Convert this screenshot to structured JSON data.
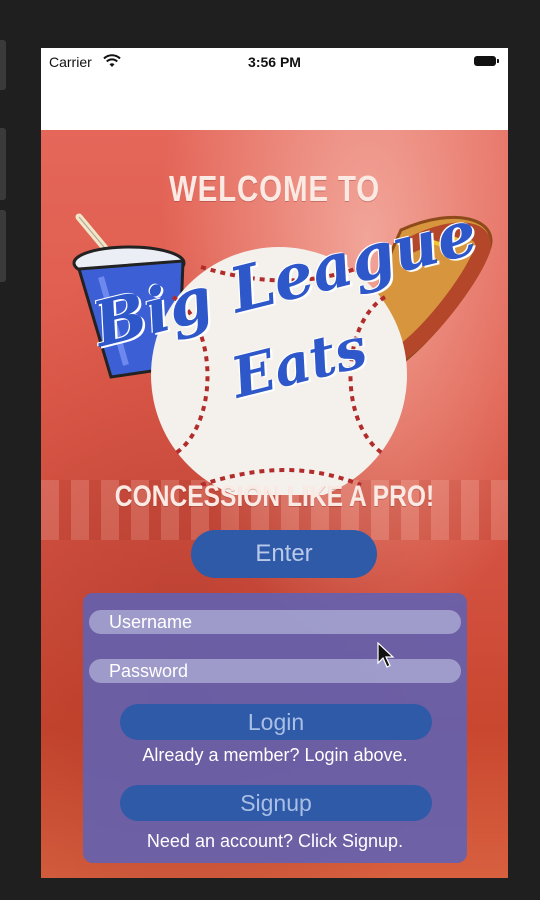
{
  "status_bar": {
    "carrier": "Carrier",
    "time": "3:56 PM"
  },
  "hero": {
    "welcome": "WELCOME TO",
    "logo_line1": "Big League",
    "logo_line2": "Eats",
    "tagline": "CONCESSION LIKE A PRO!",
    "enter_label": "Enter"
  },
  "auth": {
    "username_placeholder": "Username",
    "password_placeholder": "Password",
    "login_label": "Login",
    "login_hint": "Already a member? Login above.",
    "signup_label": "Signup",
    "signup_hint": "Need an account? Click Signup."
  },
  "colors": {
    "brand_blue": "#2e57c9",
    "button_blue": "#2f5aa8",
    "background_red": "#de5a4a",
    "panel": "#6062b4"
  },
  "icons": [
    "wifi-icon",
    "battery-icon",
    "drink-cup-icon",
    "baseball-icon",
    "hot-dog-icon",
    "cursor-icon"
  ]
}
